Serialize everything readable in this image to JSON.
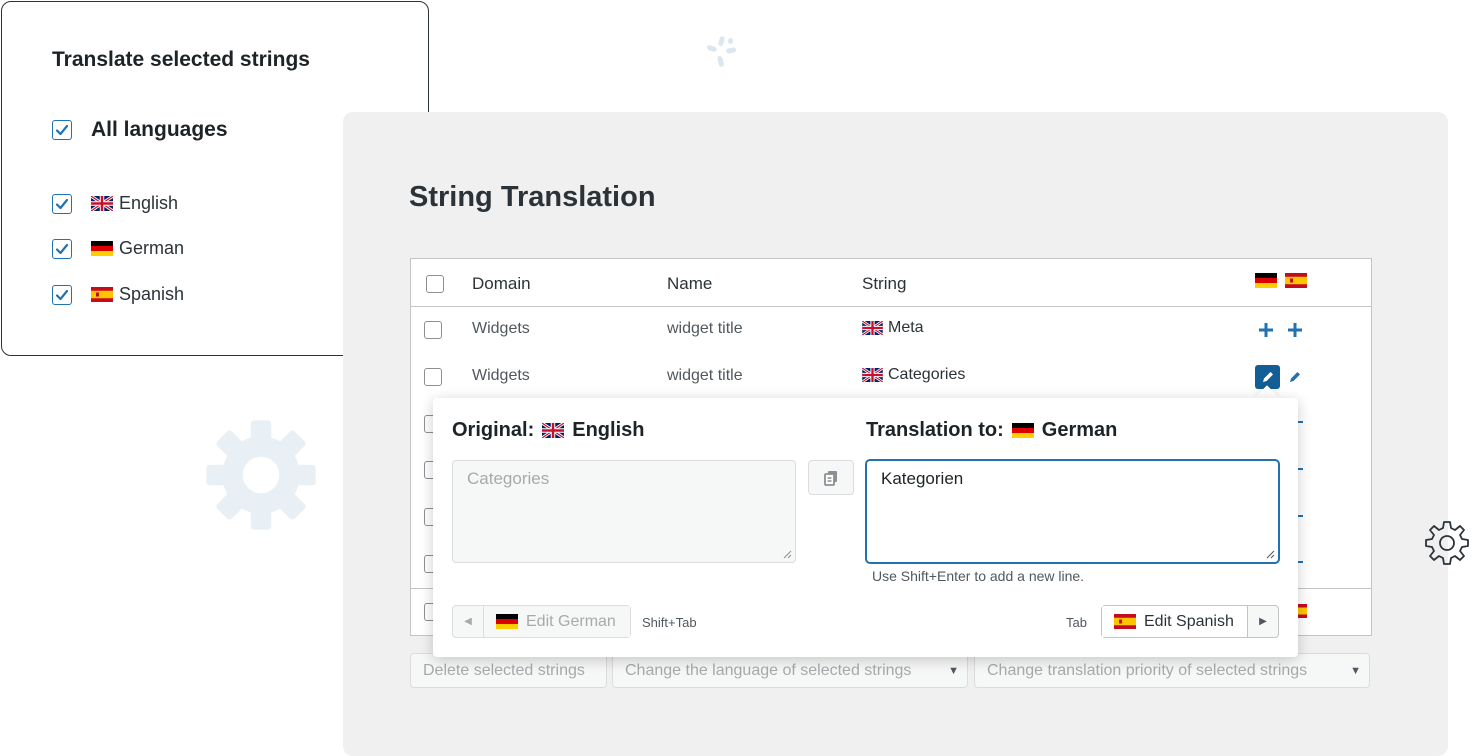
{
  "left_panel": {
    "title": "Translate selected strings",
    "all_languages": "All languages",
    "languages": [
      {
        "label": "English",
        "flag": "uk-flag-icon",
        "checked": true
      },
      {
        "label": "German",
        "flag": "de-flag-icon",
        "checked": true
      },
      {
        "label": "Spanish",
        "flag": "es-flag-icon",
        "checked": true
      }
    ]
  },
  "main": {
    "title": "String Translation",
    "columns": {
      "domain": "Domain",
      "name": "Name",
      "string": "String"
    },
    "rows": [
      {
        "domain": "Widgets",
        "name": "widget title",
        "string": "Meta",
        "actions": [
          "plus-icon",
          "plus-icon"
        ]
      },
      {
        "domain": "Widgets",
        "name": "widget title",
        "string": "Categories",
        "actions": [
          "pencil-icon-active",
          "pencil-icon"
        ]
      }
    ],
    "bulk_actions": {
      "delete": "Delete selected strings",
      "change_language": "Change the language of selected strings",
      "change_priority": "Change translation priority of selected strings"
    }
  },
  "popup": {
    "original_label": "Original:",
    "original_language": "English",
    "translation_label": "Translation to:",
    "translation_language": "German",
    "original_placeholder": "Categories",
    "translation_value": "Kategorien",
    "hint": "Use Shift+Enter to add a new line.",
    "prev_label": "Edit German",
    "prev_shortcut": "Shift+Tab",
    "next_label": "Edit Spanish",
    "next_shortcut": "Tab"
  },
  "colors": {
    "accent": "#2271b1",
    "accent_dark": "#135e96",
    "card_bg": "#f0f0f1",
    "deco": "#e8eff4"
  }
}
